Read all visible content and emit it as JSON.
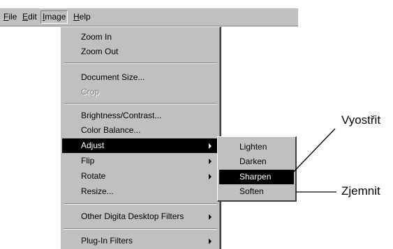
{
  "menubar": {
    "items": [
      {
        "label": "File",
        "mnemonic": "F"
      },
      {
        "label": "Edit",
        "mnemonic": "E"
      },
      {
        "label": "Image",
        "mnemonic": "I"
      },
      {
        "label": "Help",
        "mnemonic": "H"
      }
    ]
  },
  "image_menu": {
    "zoom_in": "Zoom In",
    "zoom_out": "Zoom Out",
    "document_size": "Document Size...",
    "crop": "Crop",
    "brightness_contrast": "Brightness/Contrast...",
    "color_balance": "Color Balance...",
    "adjust": "Adjust",
    "flip": "Flip",
    "rotate": "Rotate",
    "resize": "Resize...",
    "other_filters": "Other Digita Desktop Filters",
    "plugin_filters": "Plug-In Filters"
  },
  "adjust_submenu": {
    "lighten": "Lighten",
    "darken": "Darken",
    "sharpen": "Sharpen",
    "soften": "Soften"
  },
  "callouts": {
    "sharpen_label": "Vyostřit",
    "soften_label": "Zjemnit"
  }
}
